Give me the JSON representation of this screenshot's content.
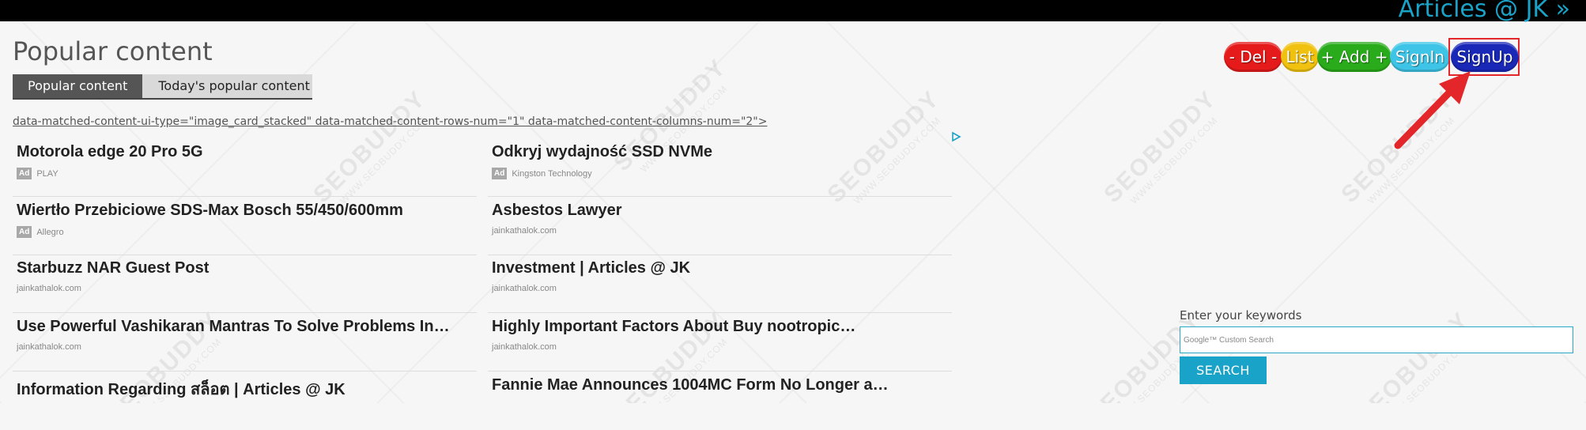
{
  "header": {
    "site_link": "Articles @ JK »"
  },
  "page": {
    "title": "Popular content",
    "tabs": [
      {
        "label": "Popular content"
      },
      {
        "label": "Today's popular content"
      }
    ],
    "ad_attributes_text": "data-matched-content-ui-type=\"image_card_stacked\" data-matched-content-rows-num=\"1\" data-matched-content-columns-num=\"2\">"
  },
  "ads": [
    {
      "title": "Motorola edge 20 Pro 5G",
      "badge": "Ad",
      "source": "PLAY"
    },
    {
      "title": "Odkryj wydajność SSD NVMe",
      "badge": "Ad",
      "source": "Kingston Technology"
    },
    {
      "title": "Wiertło Przebiciowe SDS-Max Bosch 55/450/600mm",
      "badge": "Ad",
      "source": "Allegro"
    },
    {
      "title": "Asbestos Lawyer",
      "badge": "",
      "source": "jainkathalok.com"
    },
    {
      "title": "Starbuzz NAR Guest Post",
      "badge": "",
      "source": "jainkathalok.com"
    },
    {
      "title": "Investment | Articles @ JK",
      "badge": "",
      "source": "jainkathalok.com"
    },
    {
      "title": "Use Powerful Vashikaran Mantras To Solve Problems In…",
      "badge": "",
      "source": "jainkathalok.com"
    },
    {
      "title": "Highly Important Factors About Buy nootropic…",
      "badge": "",
      "source": "jainkathalok.com"
    },
    {
      "title": "Information Regarding สล็อต | Articles @ JK",
      "badge": "",
      "source": ""
    },
    {
      "title": "Fannie Mae Announces 1004MC Form No Longer a…",
      "badge": "",
      "source": ""
    }
  ],
  "user_buttons": {
    "del": "- Del -",
    "list": "List",
    "add": "+ Add +",
    "signin": "SignIn",
    "signup": "SignUp"
  },
  "search": {
    "label": "Enter your keywords",
    "placeholder_brand": "Google™",
    "placeholder_text": "Custom Search",
    "button": "SEARCH"
  },
  "watermark": {
    "brand": "SEOBUDDY",
    "domain": "WWW.SEOBUDDY.COM"
  },
  "colors": {
    "accent": "#1aa3c8",
    "del": "#e51a1a",
    "list": "#f0c10f",
    "add": "#2aab1b",
    "signin": "#3ec4e6",
    "signup": "#1a28b8",
    "highlight": "#e2262a"
  }
}
